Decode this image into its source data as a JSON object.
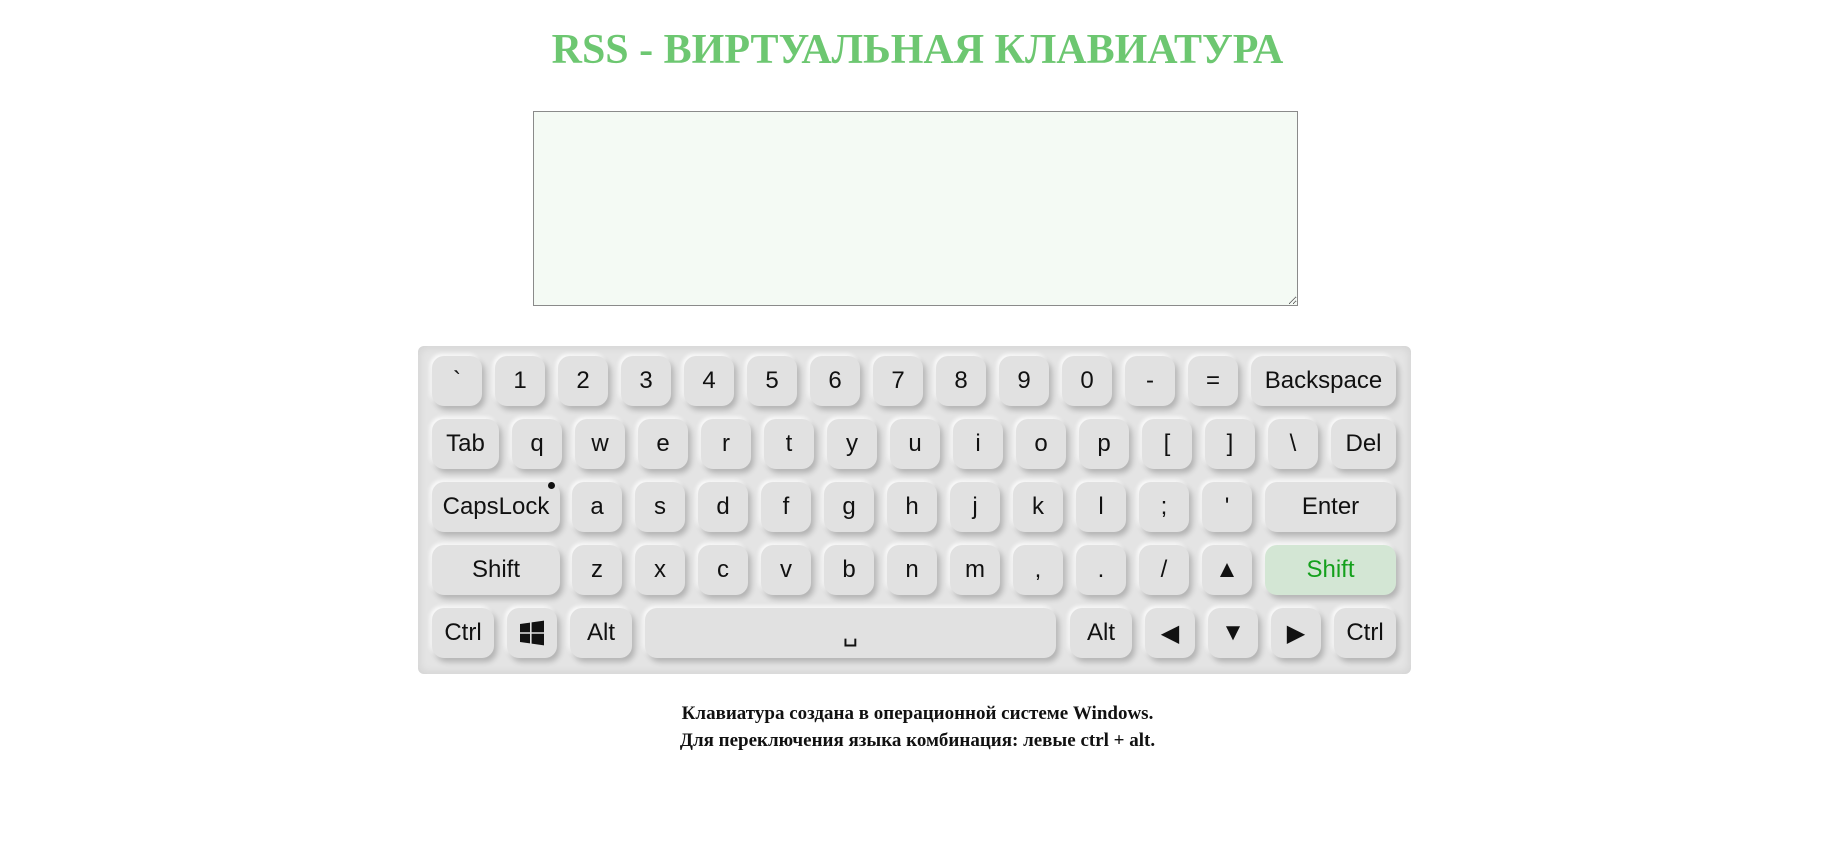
{
  "page": {
    "title": "RSS - ВИРТУАЛЬНАЯ КЛАВИАТУРА"
  },
  "textarea": {
    "value": "",
    "placeholder": ""
  },
  "keyboard": {
    "rows": [
      [
        "`",
        "1",
        "2",
        "3",
        "4",
        "5",
        "6",
        "7",
        "8",
        "9",
        "0",
        "-",
        "=",
        "Backspace"
      ],
      [
        "Tab",
        "q",
        "w",
        "e",
        "r",
        "t",
        "y",
        "u",
        "i",
        "o",
        "p",
        "[",
        "]",
        "\\",
        "Del"
      ],
      [
        "CapsLock",
        "a",
        "s",
        "d",
        "f",
        "g",
        "h",
        "j",
        "k",
        "l",
        ";",
        "'",
        "Enter"
      ],
      [
        "Shift",
        "z",
        "x",
        "c",
        "v",
        "b",
        "n",
        "m",
        ",",
        ".",
        "/",
        "▲",
        "Shift"
      ],
      [
        "Ctrl",
        "windows-icon",
        "Alt",
        "␣",
        "Alt",
        "◀",
        "▼",
        "▶",
        "Ctrl"
      ]
    ],
    "active_key": "Shift (right)",
    "capslock_indicator": "on",
    "colors": {
      "active_text": "#14a01c",
      "active_bg": "#d3e6d4",
      "key_bg": "#e1e1e1",
      "title": "#6dc771"
    }
  },
  "footer": {
    "line1": "Клавиатура создана в операционной системе Windows.",
    "line2": "Для переключения языка комбинация: левые ctrl + alt."
  }
}
